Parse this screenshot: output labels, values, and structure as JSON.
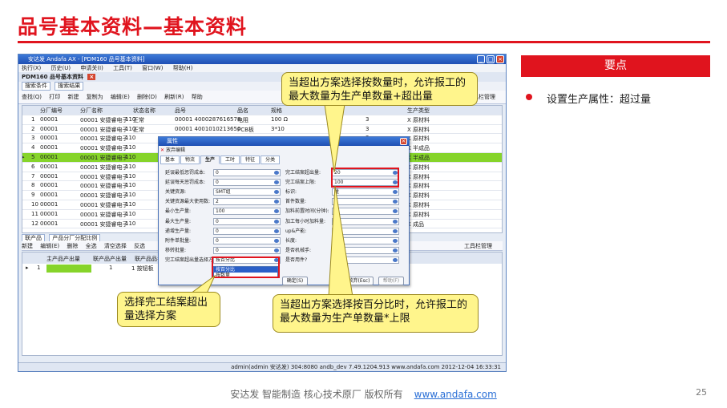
{
  "slide": {
    "title": "品号基本资料—基本资料",
    "keypoint_header": "要点",
    "bullet": "设置生产属性：超过量",
    "footer": "安达发  智能制造 核心技术原厂   版权所有",
    "footer_link": "www.andafa.com",
    "page_number": "25"
  },
  "colors": {
    "accent": "#e0141e",
    "callout_fill": "#fff58c",
    "selected_row": "#86d42a",
    "titlebar": "#2a5fc8"
  },
  "app": {
    "title": "安达发 Andafa AX - [PDM160 品号基本资料]",
    "menu": [
      "执行(X)",
      "历史(U)",
      "申请关(I)",
      "工具(T)",
      "窗口(W)",
      "帮助(H)"
    ],
    "doc_tab": "PDM160 品号基本资料",
    "subtabs": [
      "搜索条件",
      "搜索结果"
    ],
    "toolbar": [
      "查找(Q)",
      "打印",
      "新建",
      "复制为",
      "编辑(E)",
      "删除(D)",
      "刷新(R)",
      "帮助"
    ],
    "toolbar_right": "工具栏管理",
    "grid_headers": [
      "",
      "分厂编号",
      "分厂名称",
      "",
      "状态名称",
      "品号",
      "品名",
      "规格",
      "",
      "生产类型"
    ],
    "grid_rows": [
      [
        "1",
        "00001",
        "00001 安捷睿电子",
        "110",
        "正常",
        "00001 4000287616578",
        "电阻",
        "100 Ω",
        "3",
        "X 原材料"
      ],
      [
        "2",
        "00001",
        "00001 安捷睿电子",
        "110",
        "正常",
        "00001 4001010213650",
        "PCB板",
        "3*10",
        "3",
        "X 原材料"
      ],
      [
        "3",
        "00001",
        "00001 安捷睿电子",
        "110",
        "",
        "",
        "",
        "",
        "3",
        "X 原材料"
      ],
      [
        "4",
        "00001",
        "00001 安捷睿电子",
        "110",
        "",
        "",
        "",
        "",
        "3",
        "X 半成品"
      ],
      [
        "5",
        "00001",
        "00001 安捷睿电子",
        "110",
        "",
        "",
        "",
        "",
        "3",
        "X 半成品"
      ],
      [
        "6",
        "00001",
        "00001 安捷睿电子",
        "110",
        "",
        "",
        "",
        "",
        "3",
        "X 原材料"
      ],
      [
        "7",
        "00001",
        "00001 安捷睿电子",
        "110",
        "",
        "",
        "",
        "",
        "3",
        "X 原材料"
      ],
      [
        "8",
        "00001",
        "00001 安捷睿电子",
        "110",
        "",
        "",
        "",
        "",
        "3",
        "X 原材料"
      ],
      [
        "9",
        "00001",
        "00001 安捷睿电子",
        "110",
        "",
        "",
        "",
        "",
        "3",
        "X 原材料"
      ],
      [
        "10",
        "00001",
        "00001 安捷睿电子",
        "110",
        "",
        "",
        "",
        "",
        "3",
        "X 原材料"
      ],
      [
        "11",
        "00001",
        "00001 安捷睿电子",
        "110",
        "",
        "",
        "",
        "",
        "3",
        "X 原材料"
      ],
      [
        "12",
        "00001",
        "00001 安捷睿电子",
        "110",
        "",
        "",
        "",
        "",
        "1",
        "X 成品"
      ]
    ],
    "lower_tabs": [
      "联产品",
      "产品分厂分配比例"
    ],
    "lower_toolbar": [
      "新建",
      "编辑(E)",
      "删除",
      "全选",
      "清空选择",
      "反选"
    ],
    "lower_headers": [
      "主产品产出量",
      "联产品产出量",
      "联产品品名"
    ],
    "lower_row": [
      "1",
      "1",
      "1 按钮板"
    ],
    "status": "admin(admin 安达发)  304:8080  andb_dev  7.49.1204.913  www.andafa.com  2012-12-04 16:33:31"
  },
  "dialog": {
    "title": "属性",
    "menu": "放弃编辑",
    "tabs": [
      "基本",
      "物流",
      "生产",
      "工时",
      "特征",
      "分类"
    ],
    "active_tab": "生产",
    "left_fields": [
      {
        "label": "延误最低惩罚成本:",
        "value": "0"
      },
      {
        "label": "延误每天惩罚成本:",
        "value": "0"
      },
      {
        "label": "关键资源:",
        "value": "SMT组"
      },
      {
        "label": "关键资源最大使用数:",
        "value": "2"
      },
      {
        "label": "最小生产量:",
        "value": "100"
      },
      {
        "label": "最大生产量:",
        "value": "0"
      },
      {
        "label": "递增生产量:",
        "value": "0"
      },
      {
        "label": "附件单批量:",
        "value": "0"
      },
      {
        "label": "移转批量:",
        "value": "0"
      },
      {
        "label": "完工结案超出量选择方",
        "value": "按百分比"
      }
    ],
    "right_fields": [
      {
        "label": "完工结案超出量:",
        "value": "20"
      },
      {
        "label": "完工结案上限:",
        "value": "100"
      },
      {
        "label": "标识:",
        "value": "量"
      },
      {
        "label": "首件数量:",
        "value": ""
      },
      {
        "label": "加料前置时间(分钟):",
        "value": ""
      },
      {
        "label": "加工每小时加料量:",
        "value": ""
      },
      {
        "label": "up&产能:",
        "value": ""
      },
      {
        "label": "长度:",
        "value": ""
      },
      {
        "label": "是否机械手:",
        "value": ""
      },
      {
        "label": "是否用件?",
        "value": ""
      }
    ],
    "dropdown_options": [
      "按百分比",
      "按数量"
    ],
    "ok_button": "确定(S)",
    "cancel_button": "放弃(Esc)",
    "help_button": "帮助(F)"
  },
  "callouts": {
    "top": "当超出方案选择按数量时，允许报工的最大数量为生产单数量+超出量",
    "left": "选择完工结案超出量选择方案",
    "bottom": "当超出方案选择按百分比时，允许报工的最大数量为生产单数量*上限"
  }
}
